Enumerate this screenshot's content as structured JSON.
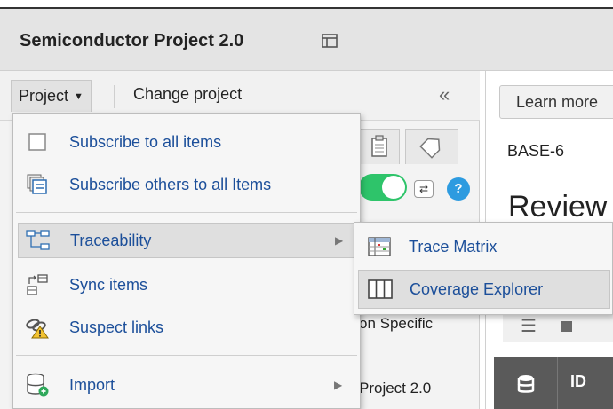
{
  "app": {
    "title": "Semiconductor Project 2.0"
  },
  "toolbar": {
    "project_label": "Project",
    "change_project_label": "Change project",
    "collapse_glyph": "«"
  },
  "background": {
    "row_text_1": "on Specific",
    "row_text_2": "Project 2.0",
    "help_glyph": "?"
  },
  "right_panel": {
    "learn_more": "Learn more",
    "item_id": "BASE-6",
    "heading": "Review",
    "column_id": "ID"
  },
  "menu": {
    "items": [
      {
        "label": "Subscribe to all items",
        "icon": "checkbox-icon"
      },
      {
        "label": "Subscribe others to all Items",
        "icon": "subscribe-others-icon"
      },
      {
        "label": "Traceability",
        "icon": "traceability-icon",
        "has_submenu": true
      },
      {
        "label": "Sync items",
        "icon": "sync-items-icon"
      },
      {
        "label": "Suspect links",
        "icon": "suspect-links-icon"
      },
      {
        "label": "Import",
        "icon": "import-icon",
        "has_submenu": true
      }
    ],
    "submenu": {
      "items": [
        {
          "label": "Trace Matrix",
          "icon": "trace-matrix-icon"
        },
        {
          "label": "Coverage Explorer",
          "icon": "coverage-explorer-icon"
        }
      ]
    }
  },
  "colors": {
    "link": "#1c4f9a",
    "toggle_on": "#2ec46a",
    "help": "#2d9be0",
    "highlight": "#dfdfdf"
  }
}
